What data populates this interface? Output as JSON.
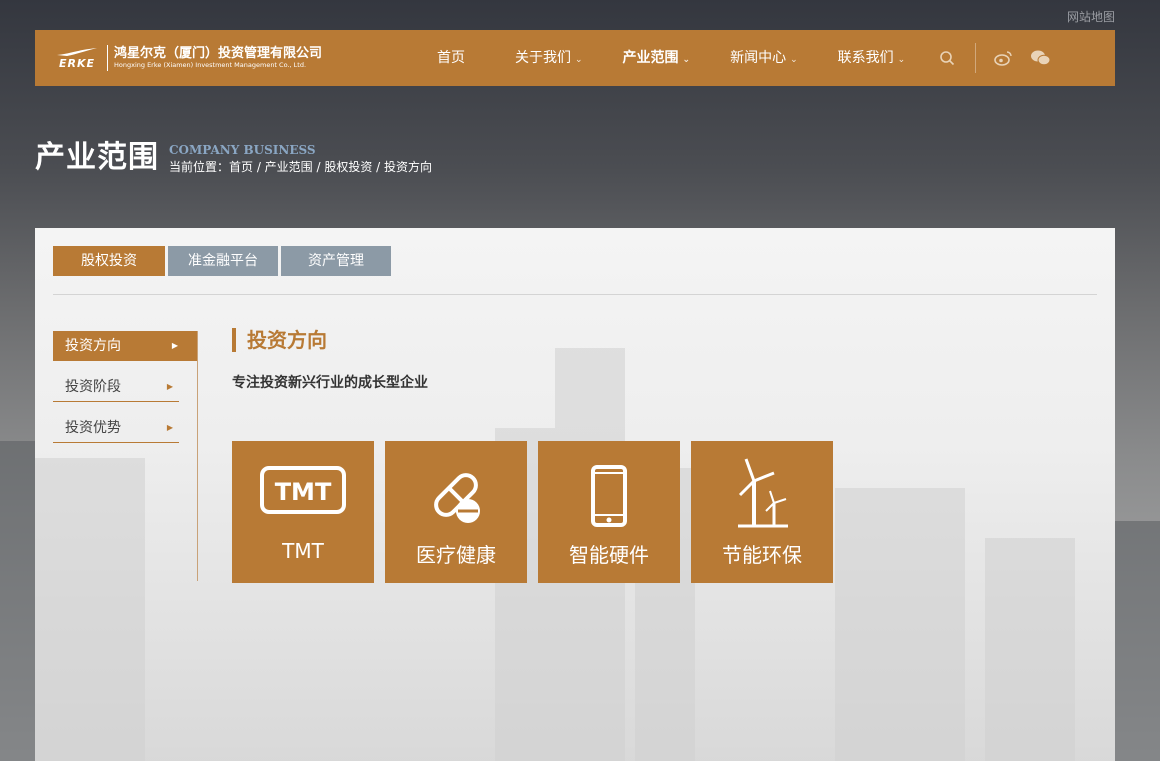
{
  "top": {
    "sitemap": "网站地图"
  },
  "logo": {
    "erke": "ERKE",
    "name_cn": "鸿星尔克（厦门）投资管理有限公司",
    "name_en": "Hongxing Erke (Xiamen) Investment Management Co., Ltd."
  },
  "nav": {
    "items": [
      {
        "label": "首页"
      },
      {
        "label": "关于我们"
      },
      {
        "label": "产业范围"
      },
      {
        "label": "新闻中心"
      },
      {
        "label": "联系我们"
      }
    ],
    "icons": [
      "search-icon",
      "weibo-icon",
      "wechat-icon"
    ]
  },
  "page": {
    "title": "产业范围",
    "subtitle": "COMPANY BUSINESS",
    "breadcrumb": "当前位置：首页 / 产业范围 / 股权投资 / 投资方向"
  },
  "tabs": [
    {
      "label": "股权投资"
    },
    {
      "label": "准金融平台"
    },
    {
      "label": "资产管理"
    }
  ],
  "sidebar": {
    "items": [
      {
        "label": "投资方向"
      },
      {
        "label": "投资阶段"
      },
      {
        "label": "投资优势"
      }
    ]
  },
  "content": {
    "title": "投资方向",
    "desc": "专注投资新兴行业的成长型企业",
    "cards": [
      {
        "label": "TMT",
        "icon": "tmt-icon",
        "icon_text": "TMT"
      },
      {
        "label": "医疗健康",
        "icon": "pill-icon"
      },
      {
        "label": "智能硬件",
        "icon": "smartphone-icon"
      },
      {
        "label": "节能环保",
        "icon": "wind-turbine-icon"
      }
    ]
  },
  "colors": {
    "accent": "#b87a35",
    "tab_inactive": "#8c9aa6",
    "subtitle": "#8aa6c3"
  }
}
